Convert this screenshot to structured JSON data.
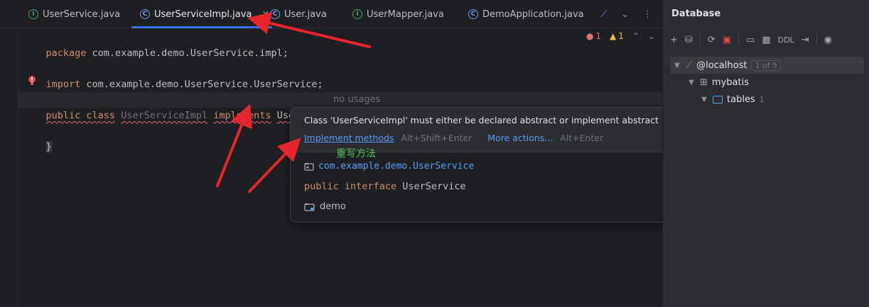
{
  "tabs": [
    {
      "label": "UserService.java",
      "kind": "interface"
    },
    {
      "label": "UserServiceImpl.java",
      "kind": "class",
      "active": true
    },
    {
      "label": "User.java",
      "kind": "class"
    },
    {
      "label": "UserMapper.java",
      "kind": "interface"
    },
    {
      "label": "DemoApplication.java",
      "kind": "app"
    }
  ],
  "editor": {
    "line1": {
      "kw": "package",
      "rest": " com.example.demo.UserService.impl;"
    },
    "line2": {
      "kw": "import",
      "rest": " com.example.demo.UserService.UserService;"
    },
    "line3": {
      "kw1": "public class",
      "name": "UserServiceImpl",
      "kw2": "implements",
      "iface": "UserService",
      "brace": "{"
    },
    "line4": {
      "brace": "}"
    },
    "usages_hint": "no usages",
    "errors": "1",
    "warnings": "1"
  },
  "popup": {
    "message": "Class 'UserServiceImpl' must either be declared abstract or implement abstract method 'findById(Integer)' in 'UserService'",
    "action1": "Implement methods",
    "action1_shortcut": "Alt+Shift+Enter",
    "action2": "More actions...",
    "action2_shortcut": "Alt+Enter",
    "package": "com.example.demo.UserService",
    "decl_kw1": "public",
    "decl_kw2": "interface",
    "decl_name": "UserService",
    "module": "demo"
  },
  "annotation": "重写方法",
  "database": {
    "title": "Database",
    "toolbar_ddl": "DDL",
    "tree": [
      {
        "label": "@localhost",
        "badge": "1 of 5"
      },
      {
        "label": "mybatis"
      },
      {
        "label": "tables",
        "count": "1"
      }
    ]
  },
  "colors": {
    "accent": "#3574f0",
    "keyword": "#cf8e6d",
    "link": "#589df6",
    "annotation": "#4fc14f",
    "arrow": "#e8242d"
  }
}
